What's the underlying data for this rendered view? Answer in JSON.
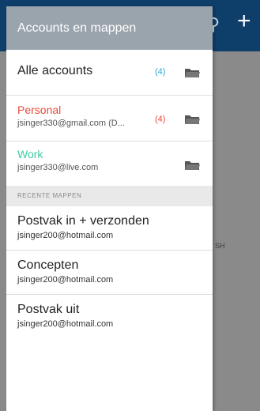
{
  "background": {
    "snippet": "SH",
    "colors": {
      "topbar": "#0e3f6b",
      "content": "#8a8a8a"
    }
  },
  "drawer": {
    "header_title": "Accounts en mappen",
    "all_accounts": {
      "label": "Alle accounts",
      "count": "(4)"
    },
    "accounts": [
      {
        "name": "Personal",
        "email": "jsinger330@gmail.com (D...",
        "count": "(4)",
        "color": "#e84a3a"
      },
      {
        "name": "Work",
        "email": "jsinger330@live.com",
        "count": "",
        "color": "#3dcba2"
      }
    ],
    "recent_section_label": "RECENTE MAPPEN",
    "recent_folders": [
      {
        "name": "Postvak in + verzonden",
        "email": "jsinger200@hotmail.com"
      },
      {
        "name": "Concepten",
        "email": "jsinger200@hotmail.com"
      },
      {
        "name": "Postvak uit",
        "email": "jsinger200@hotmail.com"
      }
    ]
  }
}
